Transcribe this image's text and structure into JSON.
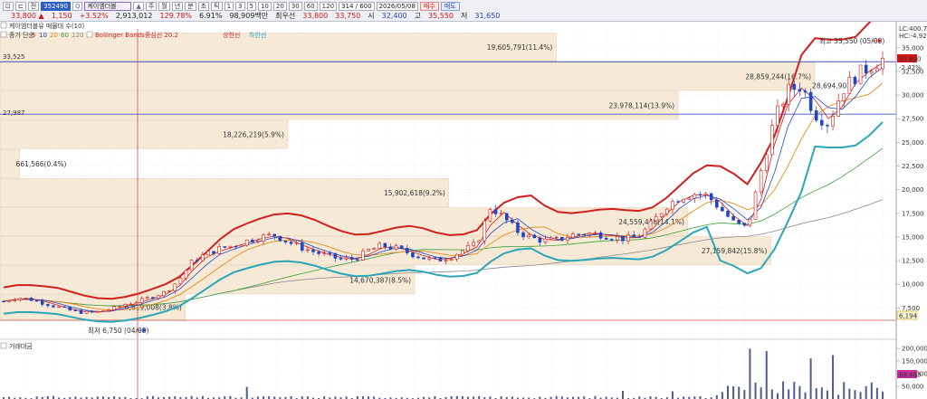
{
  "toolbar": {
    "left_buttons": [
      "⊡",
      "⊏",
      "전"
    ],
    "stock_code": "352490",
    "stock_name": "케이엠더블",
    "small_icons": [
      "Q",
      "▲"
    ],
    "period_buttons": [
      "주",
      "월",
      "년",
      "분",
      "초",
      "틱"
    ],
    "interval_buttons": [
      "1",
      "3",
      "5",
      "10",
      "20",
      "30",
      "60",
      "120"
    ],
    "count": "314 / 600",
    "date": "2026/05/08",
    "buy_label": "매수",
    "sell_label": "매도",
    "quote": {
      "price": "33,800 ▲",
      "change": "1,150",
      "change_pct": "+3.52%",
      "volume": "2,913,012",
      "volume_ratio": "129.78%",
      "turnover": "6.91%",
      "amount": "98,909백만",
      "open_label": "최우선",
      "open": "33,800",
      "ask": "33,750",
      "low_label": "시",
      "low": "32,400",
      "high_label": "고",
      "high": "35,550",
      "close_label": "저",
      "close": "31,650"
    }
  },
  "legend": {
    "price_title": "케이엠더블유 매물대 수(10)",
    "ma_title": "종가 단순",
    "ma_periods": [
      {
        "label": "5",
        "color": "#d11f1f"
      },
      {
        "label": "10",
        "color": "#1f46c4"
      },
      {
        "label": "20",
        "color": "#e58a1c"
      },
      {
        "label": "60",
        "color": "#3aa13a"
      },
      {
        "label": "120",
        "color": "#8a8a8a"
      }
    ],
    "bb_title": "Bollinger Bands중심선 20.2",
    "bb_upper": "상한선",
    "bb_lower": "하한선",
    "volume_title": "거래대금"
  },
  "colors": {
    "up": "#d31515",
    "down": "#1f46c4",
    "bb_upper": "#d11f1f",
    "bb_lower": "#2aa6b8",
    "volume_bar": "#4f5b93",
    "profile_fill": "#f6ead7",
    "line_h": "#4455cc"
  },
  "price_axis": {
    "ticks": [
      "35,000",
      "32,500",
      "30,000",
      "27,500",
      "25,000",
      "22,500",
      "20,000",
      "17,500",
      "15,000",
      "12,500",
      "10,000",
      "7,500"
    ],
    "top_labels": [
      "LC:400.74",
      "HC:-4.92"
    ],
    "current_label": "33,800",
    "current_change": "-2.42%",
    "low_label": "6,194"
  },
  "volume_axis": {
    "ticks": [
      "200,000",
      "150,000",
      "100,000",
      "50,000"
    ],
    "current_value": "68,485"
  },
  "left_labels": [
    "33,525",
    "27,987"
  ],
  "annotations": {
    "high_note": "최고 35,550 (05/08)",
    "low_note": "최저 6,750 (04/08)"
  },
  "chart_data": {
    "type": "bar",
    "title": "케이엠더블유 매물대 수(10)",
    "ylim": [
      6194,
      36800
    ],
    "volume_profile": [
      {
        "price_low": 33525,
        "price_high": 36600,
        "label": "19,605,791(11.4%)"
      },
      {
        "price_low": 30450,
        "price_high": 33525,
        "label": "28,859,244(16.7%)"
      },
      {
        "price_low": 27375,
        "price_high": 30450,
        "label": "23,978,114(13.9%)"
      },
      {
        "price_low": 24300,
        "price_high": 27375,
        "label": "18,226,219(5.9%)"
      },
      {
        "price_low": 21225,
        "price_high": 24300,
        "label": "661,566(0.4%)"
      },
      {
        "price_low": 18150,
        "price_high": 21225,
        "label": "15,902,618(9.2%)"
      },
      {
        "price_low": 15075,
        "price_high": 18150,
        "label": "24,559,448(14.1%)"
      },
      {
        "price_low": 12000,
        "price_high": 15075,
        "label": "27,159,842(15.8%)"
      },
      {
        "price_low": 8925,
        "price_high": 12000,
        "label": "14,670,387(8.5%)"
      },
      {
        "price_low": 6194,
        "price_high": 8925,
        "label": "6,619,008(3.8%)"
      }
    ],
    "price_line_labels": [
      "28,694,907"
    ],
    "close_path": [
      8.2,
      8.6,
      8.4,
      8.0,
      7.6,
      7.2,
      7.0,
      7.1,
      7.4,
      7.9,
      8.2,
      8.7,
      9.2,
      10.5,
      12.5,
      13.2,
      13.8,
      14.1,
      14.6,
      15.0,
      15.2,
      14.5,
      13.9,
      13.4,
      13.0,
      12.6,
      12.7,
      13.6,
      14.1,
      13.8,
      13.3,
      12.8,
      12.5,
      12.9,
      13.6,
      14.3,
      18.2,
      17.0,
      15.6,
      14.9,
      14.6,
      14.7,
      15.2,
      15.4,
      15.3,
      15.0,
      14.8,
      15.1,
      16.6,
      18.3,
      19.2,
      19.6,
      19.4,
      18.0,
      16.5,
      15.9,
      22.0,
      27.5,
      30.5,
      31.0,
      28.0,
      27.0,
      30.5,
      32.0,
      33.0,
      33.8
    ]
  }
}
